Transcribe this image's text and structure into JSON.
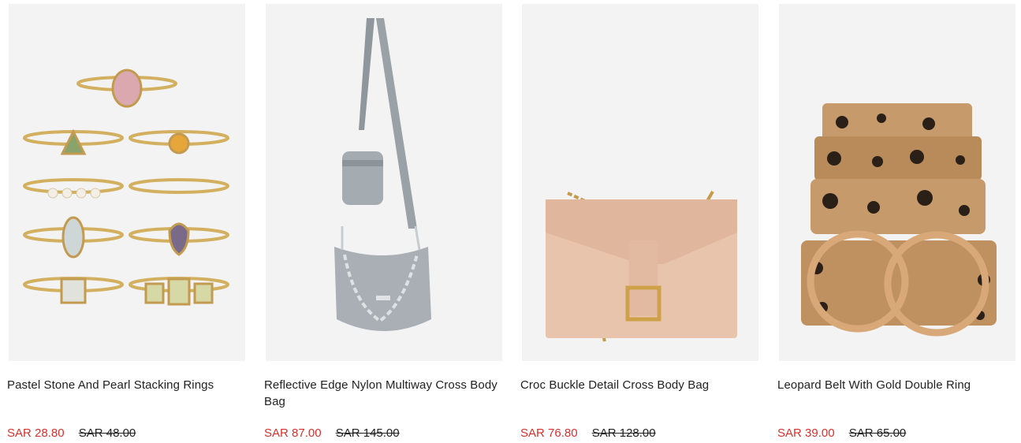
{
  "colors": {
    "sale_price": "#d9302c",
    "text": "#222222",
    "image_bg": "#f3f3f3"
  },
  "products": [
    {
      "name": "Pastel Stone And Pearl Stacking Rings",
      "sale_price": "SAR 28.80",
      "original_price": "SAR 48.00",
      "image": "rings-image"
    },
    {
      "name": "Reflective Edge Nylon Multiway Cross Body Bag",
      "sale_price": "SAR 87.00",
      "original_price": "SAR 145.00",
      "image": "grey-bag-image"
    },
    {
      "name": "Croc Buckle Detail Cross Body Bag",
      "sale_price": "SAR 76.80",
      "original_price": "SAR 128.00",
      "image": "pink-bag-image"
    },
    {
      "name": "Leopard Belt With Gold Double Ring",
      "sale_price": "SAR 39.00",
      "original_price": "SAR 65.00",
      "image": "leopard-belt-image"
    }
  ]
}
